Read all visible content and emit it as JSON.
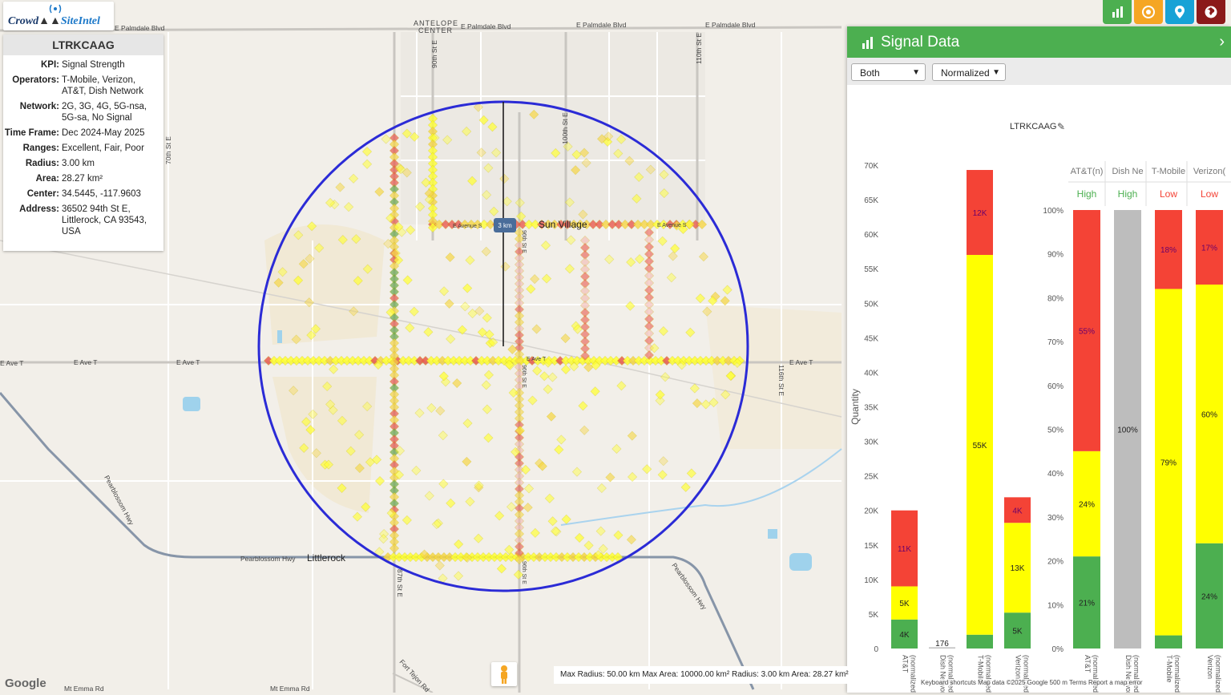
{
  "logo": {
    "part1": "Crowd",
    "part2": "SiteIntel"
  },
  "info_panel": {
    "title": "LTRKCAAG",
    "rows": [
      {
        "key": "KPI:",
        "value": "Signal Strength"
      },
      {
        "key": "Operators:",
        "value": "T-Mobile, Verizon, AT&T, Dish Network"
      },
      {
        "key": "Network:",
        "value": "2G, 3G, 4G, 5G-nsa, 5G-sa, No Signal"
      },
      {
        "key": "Time Frame:",
        "value": "Dec 2024-May 2025"
      },
      {
        "key": "Ranges:",
        "value": "Excellent, Fair, Poor"
      },
      {
        "key": "Radius:",
        "value": "3.00 km"
      },
      {
        "key": "Area:",
        "value": "28.27 km²"
      },
      {
        "key": "Center:",
        "value": "34.5445, -117.9603"
      },
      {
        "key": "Address:",
        "value": "36502 94th St E, Littlerock, CA 93543, USA"
      }
    ]
  },
  "map": {
    "labels": [
      {
        "text": "E Palmdale Blvd"
      },
      {
        "text": "E Palmdale Blvd"
      },
      {
        "text": "E Palmdale Blvd"
      },
      {
        "text": "E Palmdale Blvd"
      },
      {
        "text": "ANTELOPE"
      },
      {
        "text": "CENTER"
      },
      {
        "text": "90th St E"
      },
      {
        "text": "100th St E"
      },
      {
        "text": "110th St E"
      },
      {
        "text": "70th St E"
      },
      {
        "text": "Sun Village"
      },
      {
        "text": "E Avenue S"
      },
      {
        "text": "E Avenue S"
      },
      {
        "text": "E Ave T"
      },
      {
        "text": "E Ave T"
      },
      {
        "text": "E Ave T"
      },
      {
        "text": "E Ave T"
      },
      {
        "text": "E Ave T"
      },
      {
        "text": "96th St E"
      },
      {
        "text": "96th St E"
      },
      {
        "text": "96th St E"
      },
      {
        "text": "87th St E"
      },
      {
        "text": "116th St E"
      },
      {
        "text": "Pearblossom Hwy"
      },
      {
        "text": "Pearblossom Hwy"
      },
      {
        "text": "Pearblossom Hwy"
      },
      {
        "text": "Littlerock"
      },
      {
        "text": "Fort Tejon Rd"
      },
      {
        "text": "Mt Emma Rd"
      },
      {
        "text": "Mt Emma Rd"
      },
      {
        "text": "Pearblossom"
      }
    ],
    "radius_label": "3 km",
    "status_text": "Max Radius: 50.00 km Max Area: 10000.00 km² Radius: 3.00 km Area: 28.27 km²",
    "google": "Google",
    "legal": "Keyboard shortcuts    Map data ©2025 Google    500 m    Terms    Report a map error"
  },
  "toolbar": [
    {
      "icon": "bar-chart-icon",
      "color": "#4caf50"
    },
    {
      "icon": "target-icon",
      "color": "#f5a623"
    },
    {
      "icon": "pin-icon",
      "color": "#17a2d6"
    },
    {
      "icon": "globe-icon",
      "color": "#8b1a1a"
    }
  ],
  "signal_panel": {
    "title": "Signal Data",
    "selects": {
      "left": "Both",
      "right": "Normalized"
    },
    "chart_title": "LTRKCAAG",
    "colors": {
      "excellent": "#4caf50",
      "fair": "#ffff00",
      "poor": "#f44336",
      "nosignal": "#bdbdbd",
      "axis": "#888888"
    }
  },
  "chart_data": [
    {
      "type": "bar",
      "stacked": true,
      "title": "LTRKCAAG",
      "ylabel": "Quantity",
      "ylim": [
        0,
        70000
      ],
      "yticks": [
        "0",
        "5K",
        "10K",
        "15K",
        "20K",
        "25K",
        "30K",
        "35K",
        "40K",
        "45K",
        "50K",
        "55K",
        "60K",
        "65K",
        "70K"
      ],
      "categories": [
        "AT&T (normalized)",
        "Dish Network (normalized)",
        "T-Mobile (normalized)",
        "Verizon (normalized)"
      ],
      "series": [
        {
          "name": "Excellent",
          "values": [
            4200,
            0,
            2000,
            5200
          ],
          "labels": [
            "4K",
            "",
            "",
            "5K"
          ]
        },
        {
          "name": "Fair",
          "values": [
            4800,
            0,
            55000,
            13000
          ],
          "labels": [
            "5K",
            "",
            "55K",
            "13K"
          ]
        },
        {
          "name": "Poor",
          "values": [
            11000,
            0,
            12300,
            3700
          ],
          "labels": [
            "11K",
            "",
            "12K",
            "4K"
          ]
        },
        {
          "name": "No Signal",
          "values": [
            0,
            176,
            0,
            0
          ],
          "labels": [
            "",
            "176",
            "",
            ""
          ]
        }
      ],
      "legend": "bottom"
    },
    {
      "type": "bar",
      "stacked": true,
      "ylim": [
        0,
        100
      ],
      "yticks": [
        "0%",
        "10%",
        "20%",
        "30%",
        "40%",
        "50%",
        "60%",
        "70%",
        "80%",
        "90%",
        "100%"
      ],
      "header": [
        "AT&T(n)",
        "Dish Ne",
        "T-Mobile",
        "Verizon("
      ],
      "ratings": [
        "High",
        "High",
        "Low",
        "Low"
      ],
      "categories": [
        "AT&T (normalized)",
        "Dish Network (normalized)",
        "T-Mobile (normalized)",
        "Verizon (normalized)"
      ],
      "series": [
        {
          "name": "Excellent",
          "values": [
            21,
            0,
            3,
            24
          ],
          "labels": [
            "21%",
            "",
            "",
            "24%"
          ]
        },
        {
          "name": "Fair",
          "values": [
            24,
            0,
            79,
            59
          ],
          "labels": [
            "24%",
            "",
            "79%",
            "60%"
          ]
        },
        {
          "name": "Poor",
          "values": [
            55,
            0,
            18,
            17
          ],
          "labels": [
            "55%",
            "",
            "18%",
            "17%"
          ]
        },
        {
          "name": "No Signal",
          "values": [
            0,
            100,
            0,
            0
          ],
          "labels": [
            "",
            "100%",
            "",
            ""
          ]
        }
      ],
      "legend": "bottom"
    }
  ]
}
